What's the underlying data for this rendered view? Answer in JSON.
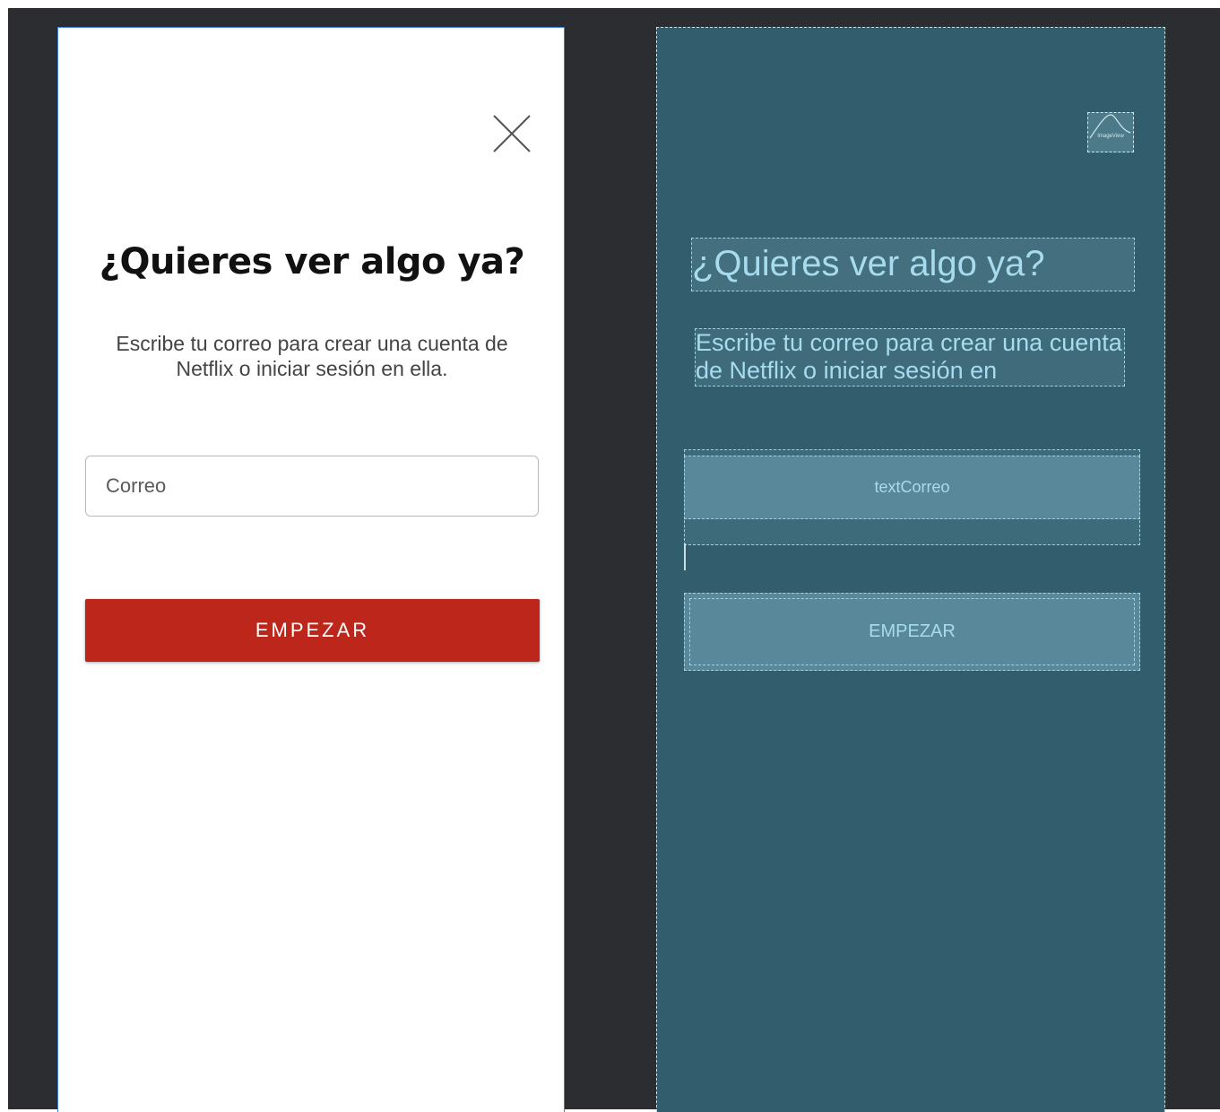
{
  "design_view": {
    "title": "¿Quieres ver algo ya?",
    "subtitle": "Escribe tu correo para crear una cuenta de Netflix o iniciar sesión en ella.",
    "email_placeholder": "Correo",
    "start_button_label": "EMPEZAR",
    "close_icon": "close-icon",
    "accent_color": "#bd271b"
  },
  "blueprint_view": {
    "image_label": "ImageView",
    "title": "¿Quieres ver algo ya?",
    "subtitle": "Escribe tu correo para crear una cuenta de Netflix o iniciar sesión en",
    "text_input_id": "textCorreo",
    "button_label": "EMPEZAR",
    "background_color": "#315d6c"
  }
}
